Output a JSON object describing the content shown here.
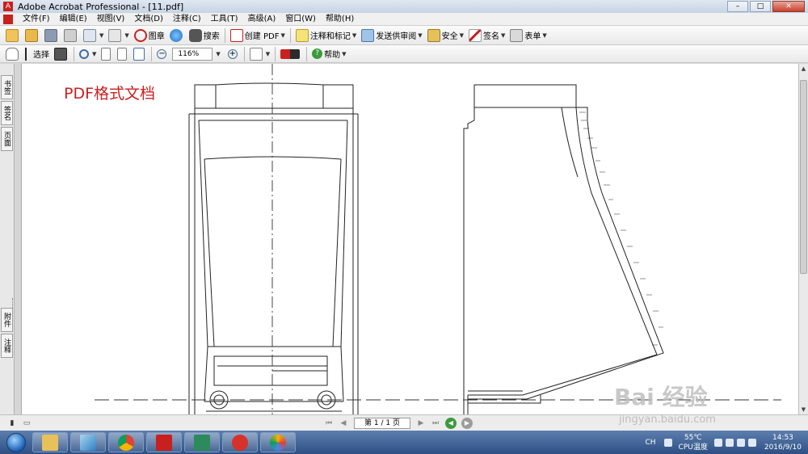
{
  "window": {
    "title": "Adobe Acrobat Professional - [11.pdf]",
    "controls": [
      "–",
      "□",
      "✕"
    ]
  },
  "menu": [
    "文件(F)",
    "编辑(E)",
    "视图(V)",
    "文档(D)",
    "注释(C)",
    "工具(T)",
    "高级(A)",
    "窗口(W)",
    "帮助(H)"
  ],
  "toolbar1": {
    "stamp": "图章",
    "search": "搜索",
    "create_pdf": "创建 PDF",
    "comment_markup": "注释和标记",
    "send_review": "发送供审阅",
    "secure": "安全",
    "sign": "签名",
    "forms": "表单"
  },
  "toolbar2": {
    "select": "选择",
    "zoom_value": "116%",
    "help": "帮助"
  },
  "leftnav": [
    "书签",
    "签名",
    "页面",
    "附件",
    "注释"
  ],
  "document": {
    "label": "PDF格式文档"
  },
  "statusbar": {
    "page": "第 1 / 1 页"
  },
  "taskbar": {
    "ime": "CH",
    "temp_value": "55℃",
    "temp_label": "CPU温度",
    "time": "14:53",
    "date": "2016/9/10"
  },
  "watermark": {
    "brand": "Bai 经验",
    "url": "jingyan.baidu.com"
  },
  "colors": {
    "acrobat_red": "#c8201f",
    "taskbar_blue": "#2d4f84"
  }
}
